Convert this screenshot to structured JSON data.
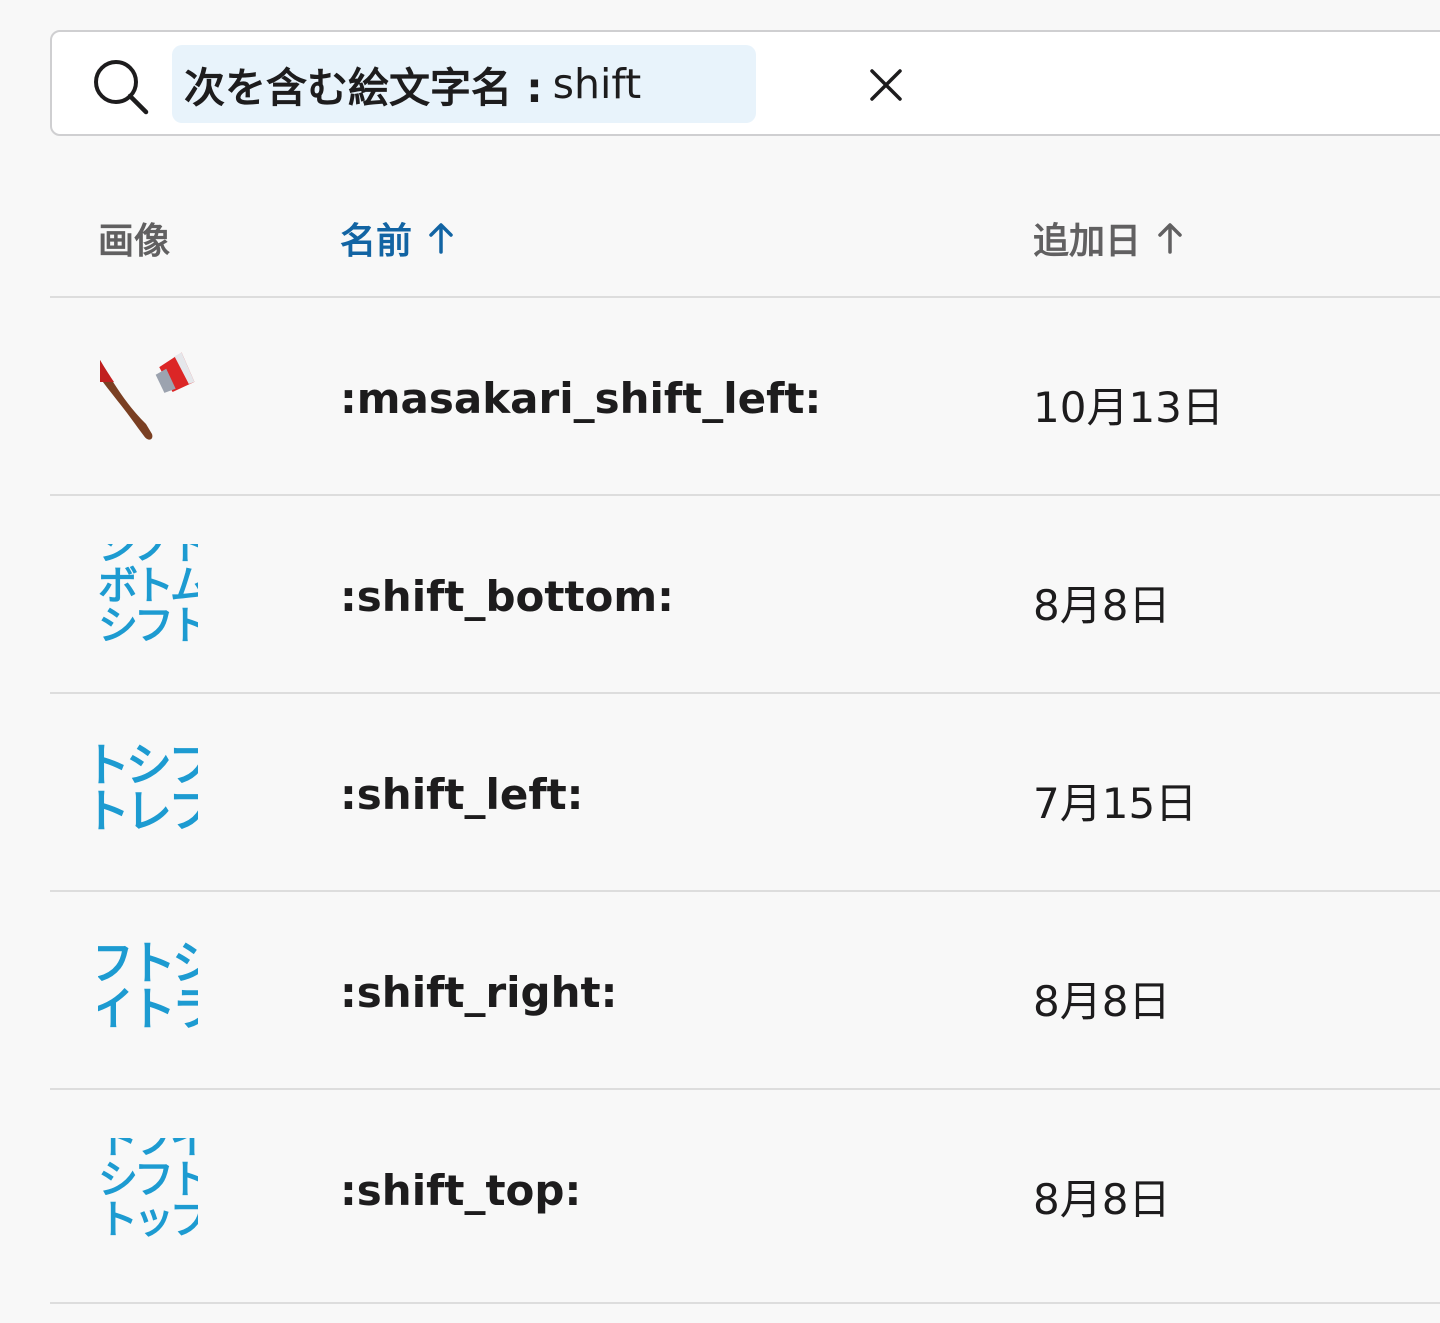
{
  "search": {
    "filter_label": "次を含む絵文字名 :",
    "filter_value": "shift"
  },
  "table": {
    "headers": {
      "image": "画像",
      "name": "名前",
      "date_added": "追加日"
    },
    "rows": [
      {
        "image": "axe-emoji",
        "name": ":masakari_shift_left:",
        "date": "10月13日"
      },
      {
        "image": "text-emoji",
        "image_text": [
          "シノト",
          "ボトム",
          "シフト"
        ],
        "name": ":shift_bottom:",
        "date": "8月8日"
      },
      {
        "image": "text-emoji",
        "image_text": [
          "トシフ",
          "トレフ"
        ],
        "name": ":shift_left:",
        "date": "7月15日"
      },
      {
        "image": "text-emoji",
        "image_text": [
          "フトシ",
          "イトラ"
        ],
        "name": ":shift_right:",
        "date": "8月8日"
      },
      {
        "image": "text-emoji",
        "image_text": [
          "トフイ",
          "シフト",
          "トップ"
        ],
        "name": ":shift_top:",
        "date": "8月8日"
      }
    ]
  },
  "colors": {
    "accent": "#1264a3",
    "emoji_blue": "#1d9bd1",
    "chip_bg": "#e8f3fb"
  }
}
